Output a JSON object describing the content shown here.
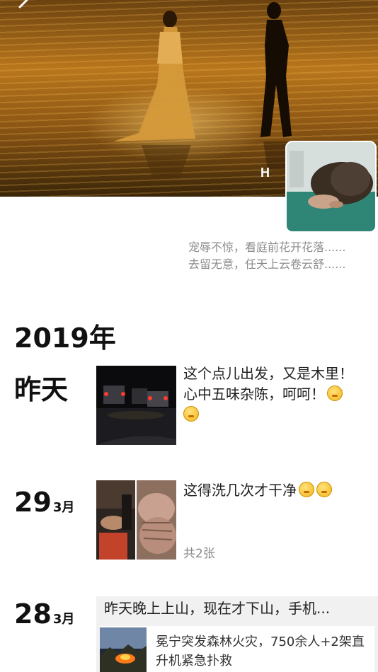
{
  "profile": {
    "name": "H",
    "signature_line1": "宠辱不惊，看庭前花开花落......",
    "signature_line2": "去留无意，任天上云卷云舒......"
  },
  "timeline": {
    "year": "2019年",
    "posts": [
      {
        "date_label": "昨天",
        "text_line1": "这个点儿出发，又是木里！",
        "text_line2": "心中五味杂陈，呵呵！"
      },
      {
        "day": "29",
        "month": "3月",
        "text": "这得洗几次才干净",
        "photo_count": "共2张"
      },
      {
        "day": "28",
        "month": "3月",
        "text": "昨天晚上上山，现在才下山，手机...",
        "link_title": "冕宁突发森林火灾，750余人+2架直升机紧急扑救"
      }
    ]
  },
  "icons": {
    "back": "back-arrow-icon",
    "emoji": "emoji-icon"
  },
  "colors": {
    "signature": "#8c8c8c",
    "share_bg": "#f1f1f1"
  }
}
